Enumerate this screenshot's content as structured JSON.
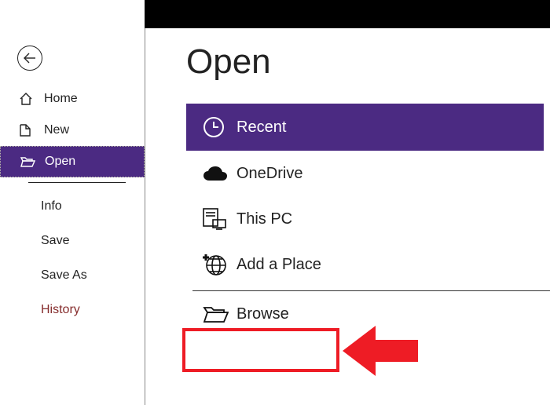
{
  "page": {
    "title": "Open"
  },
  "sidebar": {
    "items": [
      {
        "label": "Home"
      },
      {
        "label": "New"
      },
      {
        "label": "Open"
      }
    ],
    "sub_items": [
      {
        "label": "Info"
      },
      {
        "label": "Save"
      },
      {
        "label": "Save As"
      },
      {
        "label": "History"
      }
    ]
  },
  "locations": {
    "items": [
      {
        "label": "Recent"
      },
      {
        "label": "OneDrive"
      },
      {
        "label": "This PC"
      },
      {
        "label": "Add a Place"
      },
      {
        "label": "Browse"
      }
    ]
  },
  "colors": {
    "accent": "#4b2a82",
    "highlight": "#ee1c25"
  }
}
